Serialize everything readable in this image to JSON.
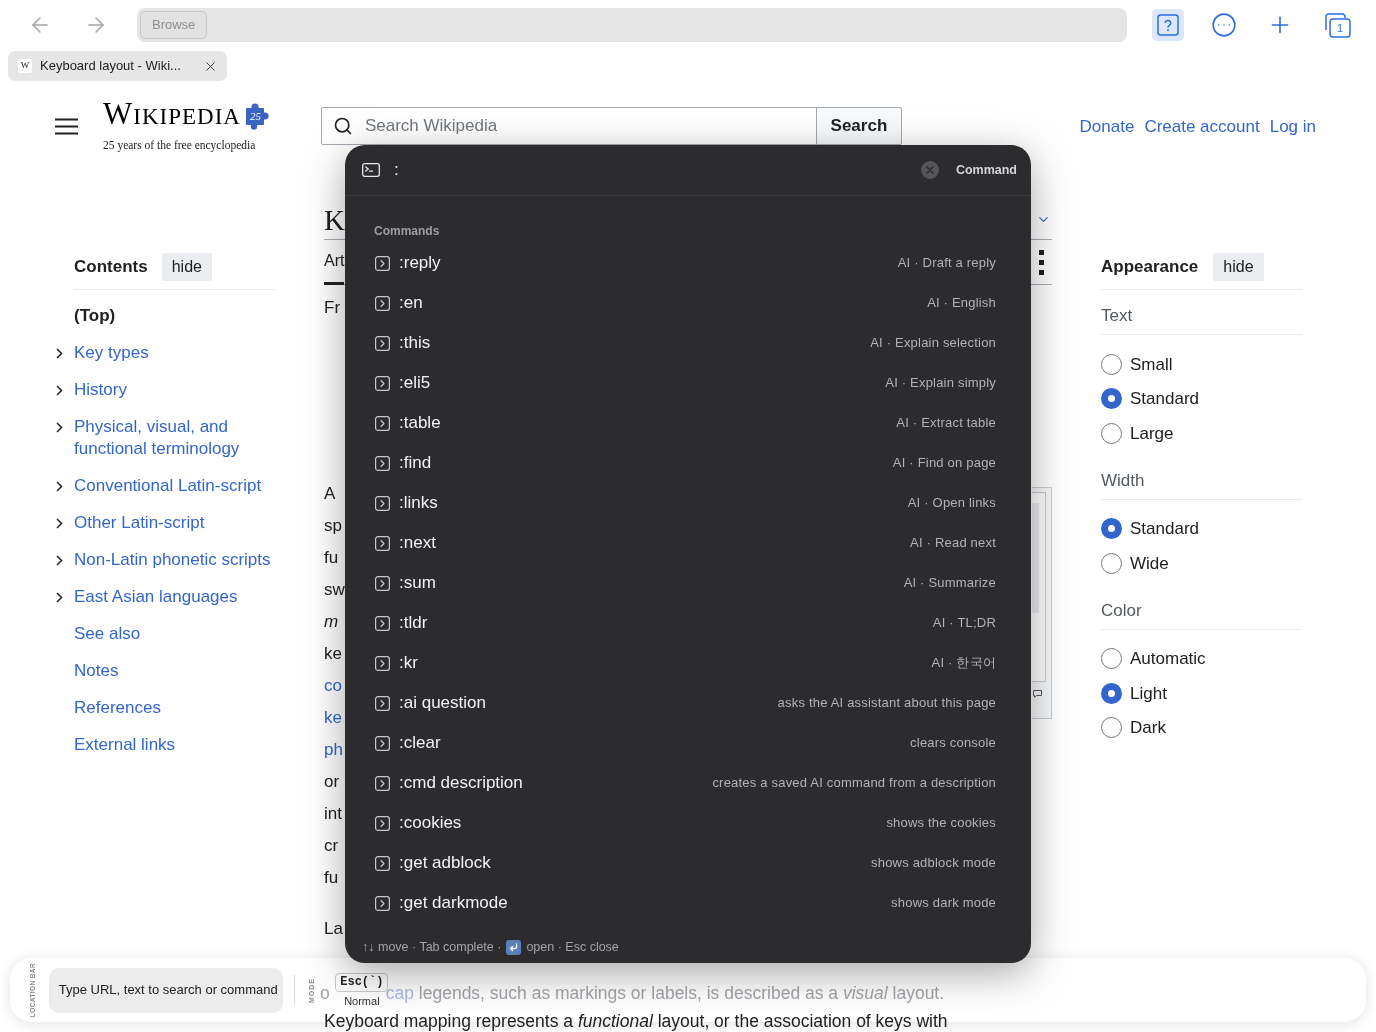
{
  "browser": {
    "help_button": {
      "active": true
    },
    "address_button": "Browse",
    "tab_count": "1",
    "tab": {
      "favicon": "W",
      "title": "Keyboard layout - Wiki..."
    }
  },
  "wiki_header": {
    "wordmark": "WIKIPEDIA",
    "badge": "25",
    "tagline": "25 years of the free encyclopedia",
    "search": {
      "placeholder": "Search Wikipedia",
      "button": "Search"
    },
    "links": [
      "Donate",
      "Create account",
      "Log in"
    ]
  },
  "contents": {
    "title": "Contents",
    "hide": "hide",
    "items": [
      {
        "label": "(Top)",
        "selected": true,
        "expandable": false
      },
      {
        "label": "Key types",
        "selected": false,
        "expandable": true
      },
      {
        "label": "History",
        "selected": false,
        "expandable": true
      },
      {
        "label": "Physical, visual, and functional terminology",
        "selected": false,
        "expandable": true
      },
      {
        "label": "Conventional Latin-script",
        "selected": false,
        "expandable": true
      },
      {
        "label": "Other Latin-script",
        "selected": false,
        "expandable": true
      },
      {
        "label": "Non-Latin phonetic scripts",
        "selected": false,
        "expandable": true
      },
      {
        "label": "East Asian languages",
        "selected": false,
        "expandable": true
      },
      {
        "label": "See also",
        "selected": false,
        "expandable": false
      },
      {
        "label": "Notes",
        "selected": false,
        "expandable": false
      },
      {
        "label": "References",
        "selected": false,
        "expandable": false
      },
      {
        "label": "External links",
        "selected": false,
        "expandable": false
      }
    ]
  },
  "article": {
    "title": "K",
    "tabs": [
      {
        "label": "Art",
        "selected": true
      }
    ],
    "intro": "Fr",
    "lines": [
      {
        "text": "A",
        "kind": "plain"
      },
      {
        "text": "sp",
        "kind": "plain"
      },
      {
        "text": "fu",
        "kind": "plain"
      },
      {
        "text": "sw",
        "kind": "plain"
      },
      {
        "text": "m",
        "kind": "italic"
      },
      {
        "text": "ke",
        "kind": "plain"
      },
      {
        "text": "co",
        "kind": "link"
      },
      {
        "text": "ke",
        "kind": "link"
      },
      {
        "text": "ph",
        "kind": "link"
      },
      {
        "text": "or",
        "kind": "plain"
      },
      {
        "text": "int",
        "kind": "plain"
      },
      {
        "text": "cr",
        "kind": "plain"
      },
      {
        "text": "fu",
        "kind": "plain"
      }
    ],
    "next": "La",
    "bottom_lines": [
      {
        "segments": [
          {
            "parts": [
              {
                "text": "o",
                "kind": "plain"
              }
            ]
          },
          {
            "parts": [
              {
                "text": "cap",
                "kind": "link"
              },
              {
                "text": " legends, such as markings or labels, is described as a *visual* layout.",
                "kind": "plain"
              }
            ]
          }
        ]
      },
      {
        "segments": [
          {
            "parts": [
              {
                "text": "Keyboard mapping represents a *functional* layout, or the association of keys with",
                "kind": "plain"
              }
            ]
          }
        ]
      }
    ]
  },
  "appearance": {
    "title": "Appearance",
    "hide": "hide",
    "groups": [
      {
        "label": "Text",
        "options": [
          {
            "label": "Small",
            "selected": false
          },
          {
            "label": "Standard",
            "selected": true
          },
          {
            "label": "Large",
            "selected": false
          }
        ]
      },
      {
        "label": "Width",
        "options": [
          {
            "label": "Standard",
            "selected": true
          },
          {
            "label": "Wide",
            "selected": false
          }
        ]
      },
      {
        "label": "Color",
        "options": [
          {
            "label": "Automatic",
            "selected": false
          },
          {
            "label": "Light",
            "selected": true
          },
          {
            "label": "Dark",
            "selected": false
          }
        ]
      }
    ]
  },
  "command_palette": {
    "input": ":",
    "mode": "Command",
    "section": "Commands",
    "commands": [
      {
        "name": ":reply",
        "description": "AI · Draft a reply"
      },
      {
        "name": ":en",
        "description": "AI · English"
      },
      {
        "name": ":this",
        "description": "AI · Explain selection"
      },
      {
        "name": ":eli5",
        "description": "AI · Explain simply"
      },
      {
        "name": ":table",
        "description": "AI · Extract table"
      },
      {
        "name": ":find",
        "description": "AI · Find on page"
      },
      {
        "name": ":links",
        "description": "AI · Open links"
      },
      {
        "name": ":next",
        "description": "AI · Read next"
      },
      {
        "name": ":sum",
        "description": "AI · Summarize"
      },
      {
        "name": ":tldr",
        "description": "AI · TL;DR"
      },
      {
        "name": ":kr",
        "description": "AI · 한국어"
      },
      {
        "name": ":ai question",
        "description": "asks the AI assistant about this page"
      },
      {
        "name": ":clear",
        "description": "clears console"
      },
      {
        "name": ":cmd description",
        "description": "creates a saved AI command from a description"
      },
      {
        "name": ":cookies",
        "description": "shows the cookies"
      },
      {
        "name": ":get adblock",
        "description": "shows adblock mode"
      },
      {
        "name": ":get darkmode",
        "description": "shows dark mode"
      }
    ],
    "hint_start": "↑↓ move · Tab complete ·",
    "hint_end": "open · Esc close"
  },
  "location_bar": {
    "label": "LOCATION BAR",
    "placeholder": "Type URL, text to search or command",
    "mode_label": "MODE",
    "mode_key": "Esc(`)",
    "mode": "Normal"
  }
}
